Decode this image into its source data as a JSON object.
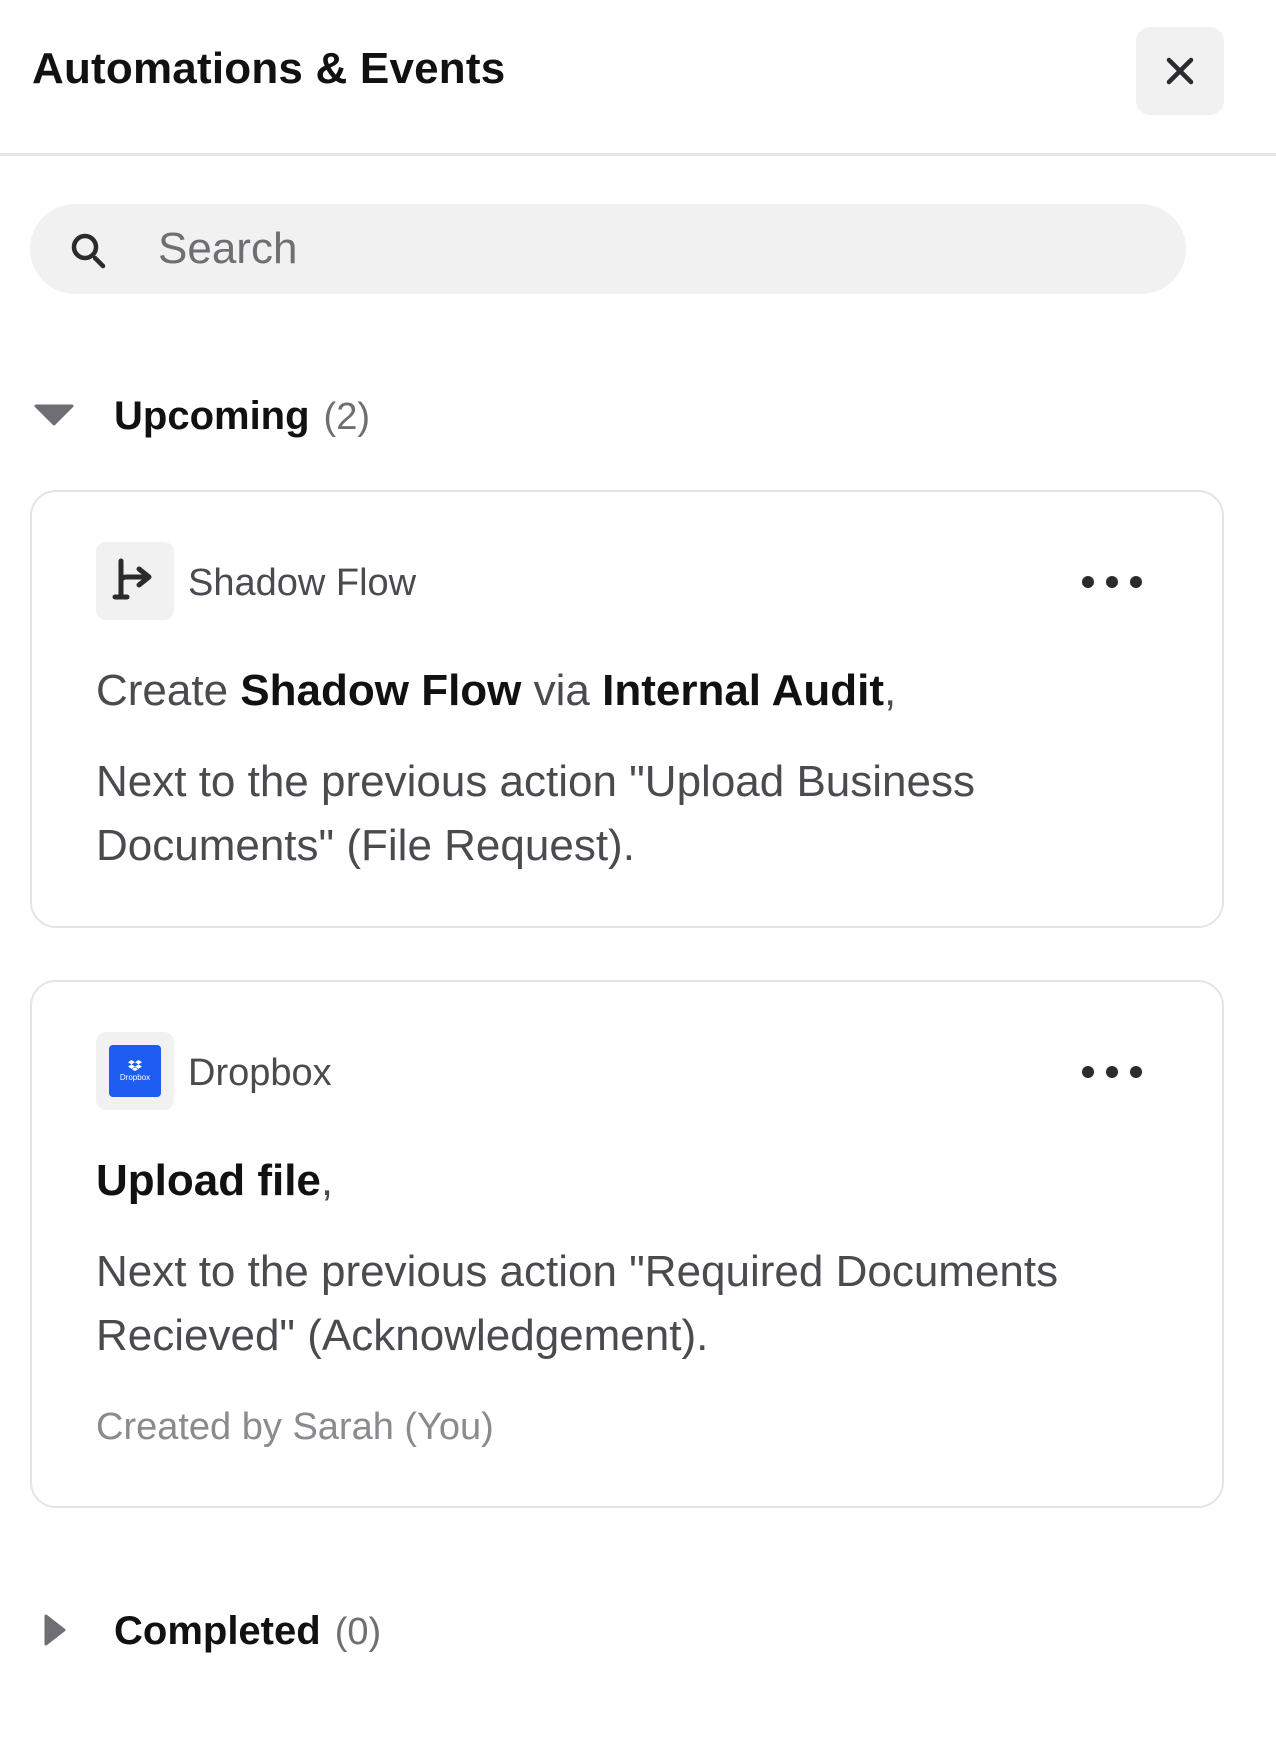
{
  "header": {
    "title": "Automations & Events",
    "close_icon": "close-icon"
  },
  "search": {
    "placeholder": "Search",
    "value": "",
    "icon": "search-icon"
  },
  "sections": {
    "upcoming": {
      "label": "Upcoming",
      "count": "(2)",
      "expanded": true
    },
    "completed": {
      "label": "Completed",
      "count": "(0)",
      "expanded": false
    }
  },
  "cards": [
    {
      "app_name": "Shadow Flow",
      "icon": "branch-flow-icon",
      "line_parts": {
        "prefix": "Create ",
        "bold1": "Shadow Flow",
        "middle": " via ",
        "bold2": "Internal Audit",
        "suffix": ","
      },
      "description": "Next to the previous action \"Upload Business Documents\" (File Request)."
    },
    {
      "app_name": "Dropbox",
      "icon": "dropbox-icon",
      "icon_wordmark": "Dropbox",
      "icon_color": "#1f5cf2",
      "line_parts": {
        "bold1": "Upload file",
        "suffix": ","
      },
      "description": "Next to the previous action \"Required Documents Recieved\" (Acknowledgement).",
      "meta": "Created by Sarah (You)"
    }
  ]
}
